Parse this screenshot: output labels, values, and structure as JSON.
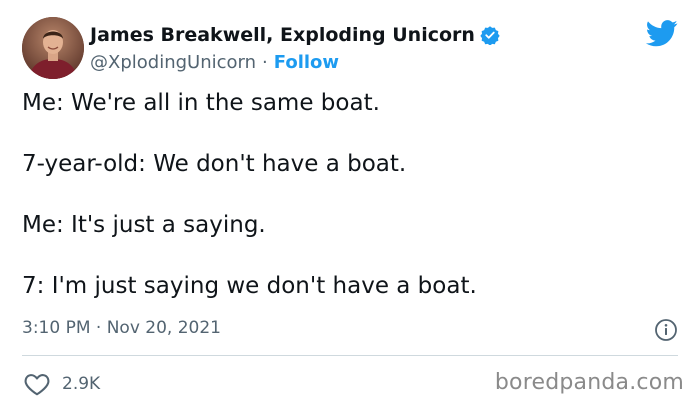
{
  "tweet": {
    "author": {
      "display_name": "James Breakwell, Exploding Unicorn",
      "handle": "@XplodingUnicorn",
      "separator": "·",
      "follow_label": "Follow",
      "verified": true,
      "avatar_icon": "avatar-photo"
    },
    "platform_icon": "twitter-bird-icon",
    "lines": [
      "Me: We're all in the same boat.",
      "7-year-old: We don't have a boat.",
      "Me: It's just a saying.",
      "7: I'm just saying we don't have a boat."
    ],
    "timestamp": "3:10 PM · Nov 20, 2021",
    "info_icon": "info-icon",
    "likes": {
      "icon": "heart-icon",
      "count": "2.9K"
    }
  },
  "watermark": "boredpanda.com",
  "colors": {
    "text": "#0f1419",
    "secondary": "#536471",
    "accent": "#1d9bf0",
    "divider": "#cfd9de",
    "watermark": "#8a8a8a"
  }
}
